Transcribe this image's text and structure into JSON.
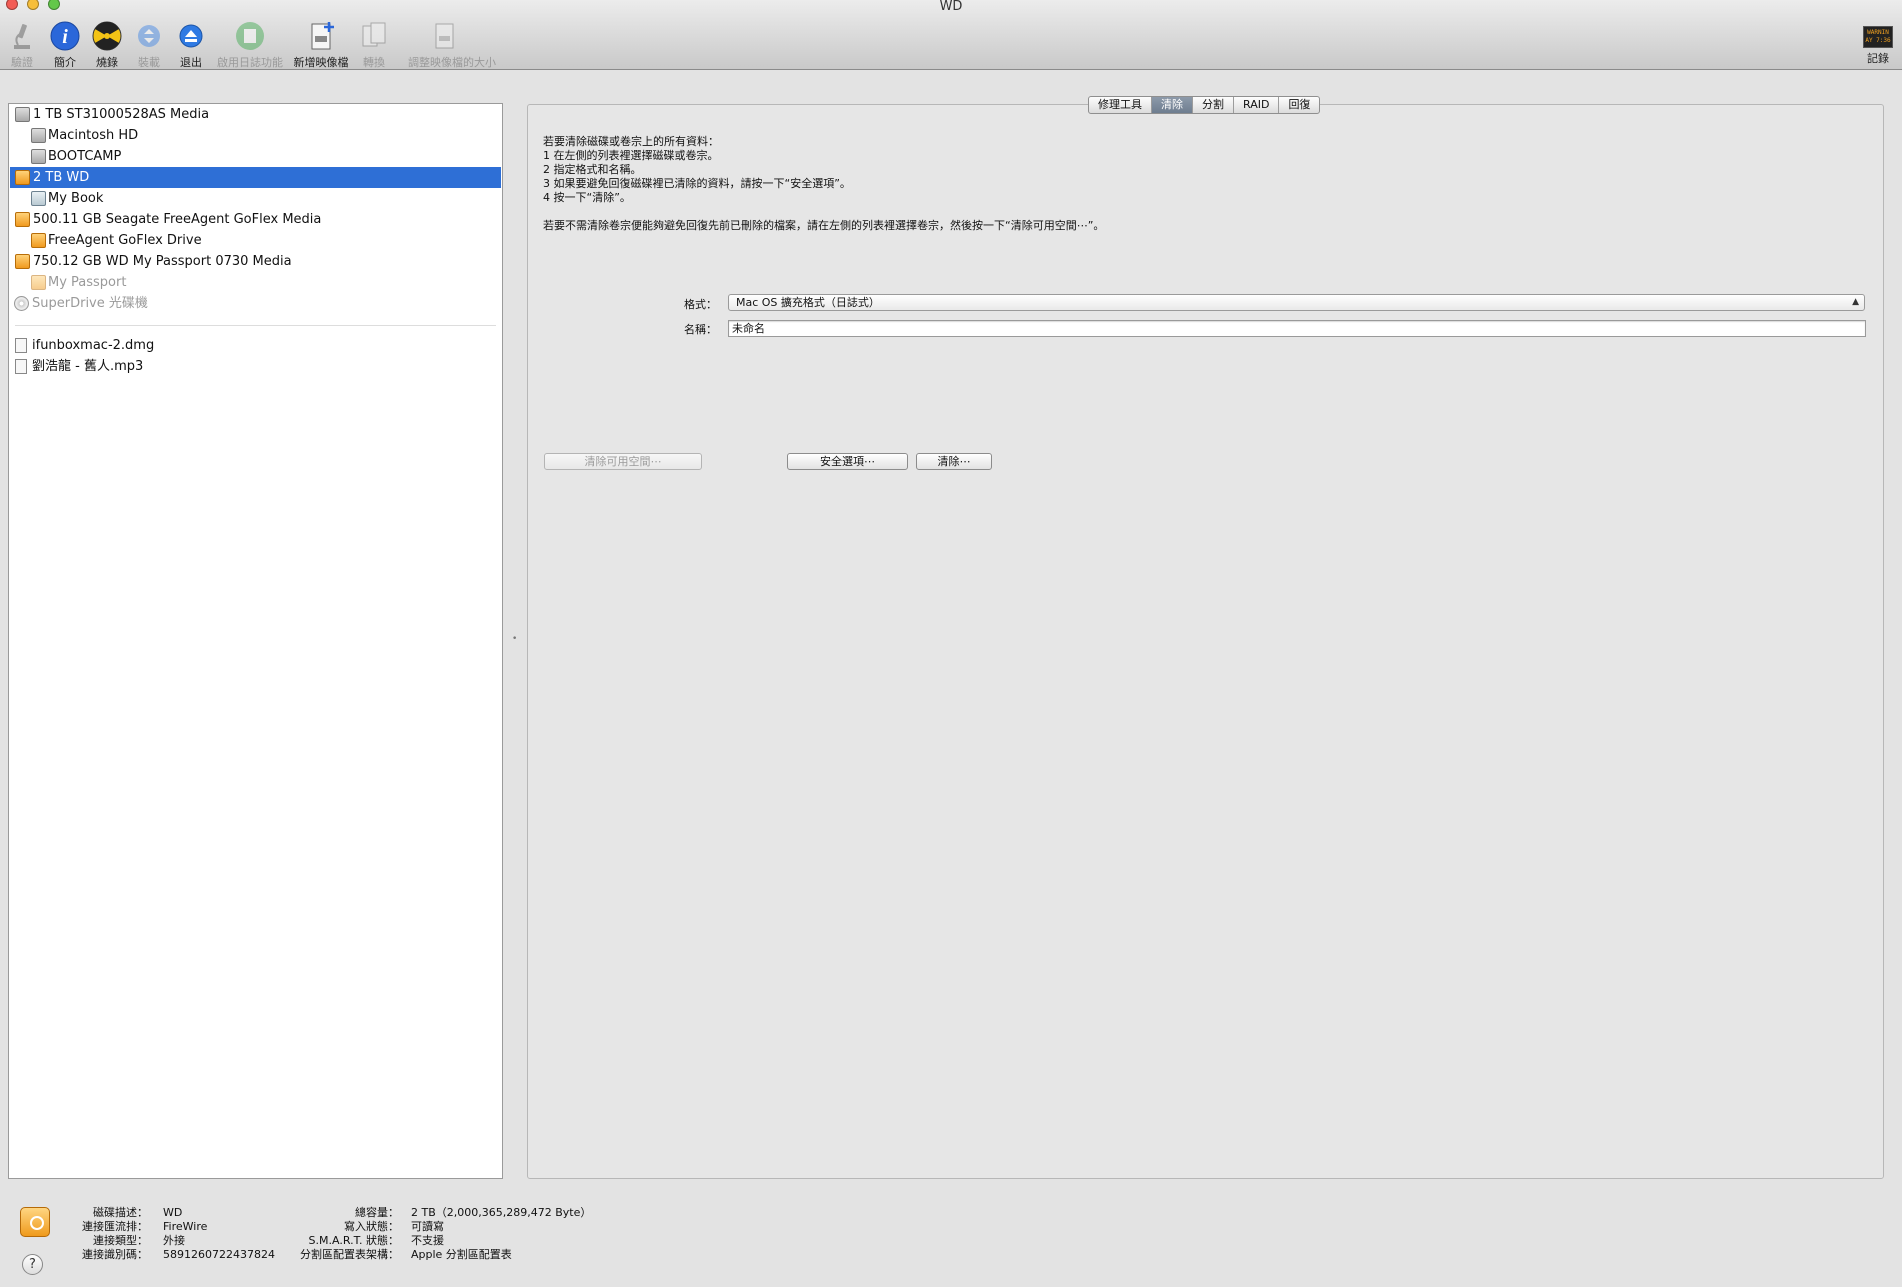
{
  "window": {
    "title": "WD"
  },
  "toolbar": {
    "items": [
      {
        "label": "驗證",
        "icon": "microscope-icon",
        "disabled": true
      },
      {
        "label": "簡介",
        "icon": "info-icon",
        "disabled": false
      },
      {
        "label": "燒錄",
        "icon": "burn-icon",
        "disabled": false
      },
      {
        "label": "裝載",
        "icon": "mount-icon",
        "disabled": true
      },
      {
        "label": "退出",
        "icon": "eject-icon",
        "disabled": false
      },
      {
        "label": "啟用日誌功能",
        "icon": "journal-icon",
        "disabled": true
      },
      {
        "label": "新增映像檔",
        "icon": "new-image-icon",
        "disabled": false
      },
      {
        "label": "轉換",
        "icon": "convert-icon",
        "disabled": true
      },
      {
        "label": "調整映像檔的大小",
        "icon": "resize-image-icon",
        "disabled": true
      }
    ],
    "log": {
      "label": "記錄",
      "icon": "log-icon",
      "badge": "WARNIN\nAY 7:36"
    }
  },
  "sidebar": {
    "items": [
      {
        "label": "1 TB ST31000528AS Media",
        "icon": "internal-disk-icon",
        "level": 0
      },
      {
        "label": "Macintosh HD",
        "icon": "volume-icon",
        "level": 1
      },
      {
        "label": "BOOTCAMP",
        "icon": "volume-icon",
        "level": 1
      },
      {
        "label": "2 TB WD",
        "icon": "external-disk-icon",
        "level": 0,
        "selected": true
      },
      {
        "label": "My Book",
        "icon": "mybook-volume-icon",
        "level": 1
      },
      {
        "label": "500.11 GB Seagate FreeAgent GoFlex Media",
        "icon": "external-disk-icon",
        "level": 0
      },
      {
        "label": "FreeAgent GoFlex Drive",
        "icon": "external-volume-icon",
        "level": 1
      },
      {
        "label": "750.12 GB WD My Passport 0730 Media",
        "icon": "external-disk-icon",
        "level": 0
      },
      {
        "label": "My Passport",
        "icon": "external-volume-icon",
        "level": 1,
        "dimmed": true
      },
      {
        "label": "SuperDrive 光碟機",
        "icon": "optical-drive-icon",
        "level": 0,
        "dimmed": true
      }
    ],
    "files": [
      {
        "label": "ifunboxmac-2.dmg",
        "icon": "disk-image-icon"
      },
      {
        "label": "劉浩龍 - 舊人.mp3",
        "icon": "disk-image-icon"
      }
    ]
  },
  "tabs": [
    {
      "label": "修理工具"
    },
    {
      "label": "清除",
      "active": true
    },
    {
      "label": "分割"
    },
    {
      "label": "RAID"
    },
    {
      "label": "回復"
    }
  ],
  "erase": {
    "instructions": [
      "若要清除磁碟或卷宗上的所有資料：",
      "1  在左側的列表裡選擇磁碟或卷宗。",
      "2  指定格式和名稱。",
      "3  如果要避免回復磁碟裡已清除的資料，請按一下“安全選項”。",
      "4  按一下“清除”。"
    ],
    "free_space_note": "若要不需清除卷宗便能夠避免回復先前已刪除的檔案，請在左側的列表裡選擇卷宗，然後按一下“清除可用空間⋯”。",
    "format_label": "格式：",
    "format_value": "Mac OS 擴充格式（日誌式）",
    "name_label": "名稱：",
    "name_value": "未命名",
    "erase_free_space_button": "清除可用空間⋯",
    "security_options_button": "安全選項⋯",
    "erase_button": "清除⋯"
  },
  "info": {
    "left": [
      {
        "key": "磁碟描述：",
        "value": "WD"
      },
      {
        "key": "連接匯流排：",
        "value": "FireWire"
      },
      {
        "key": "連接類型：",
        "value": "外接"
      },
      {
        "key": "連接識別碼：",
        "value": "5891260722437824"
      }
    ],
    "right": [
      {
        "key": "總容量：",
        "value": "2 TB（2,000,365,289,472 Byte）"
      },
      {
        "key": "寫入狀態：",
        "value": "可讀寫"
      },
      {
        "key": "S.M.A.R.T. 狀態：",
        "value": "不支援"
      },
      {
        "key": "分割區配置表架構：",
        "value": "Apple 分割區配置表"
      }
    ],
    "help_label": "?"
  },
  "colors": {
    "selection": "#2e6fd6",
    "accent_orange": "#f09a1e"
  }
}
